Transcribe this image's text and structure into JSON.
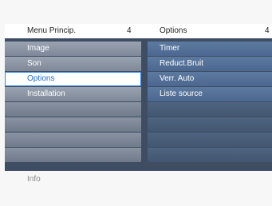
{
  "header": {
    "left_title": "Menu Princip.",
    "left_count": "4",
    "right_title": "Options",
    "right_count": "4"
  },
  "main_menu": {
    "items": [
      {
        "label": "Image"
      },
      {
        "label": "Son"
      },
      {
        "label": "Options",
        "selected": true
      },
      {
        "label": "Installation"
      }
    ]
  },
  "options_menu": {
    "items": [
      {
        "label": "Timer"
      },
      {
        "label": "Reduct.Bruit"
      },
      {
        "label": "Verr. Auto"
      },
      {
        "label": "Liste source"
      }
    ]
  },
  "footer": {
    "info_label": "Info"
  },
  "colors": {
    "panel_background": "#3f4d63",
    "selection_text": "#1f6fd1",
    "selection_border": "#2f87e8"
  }
}
